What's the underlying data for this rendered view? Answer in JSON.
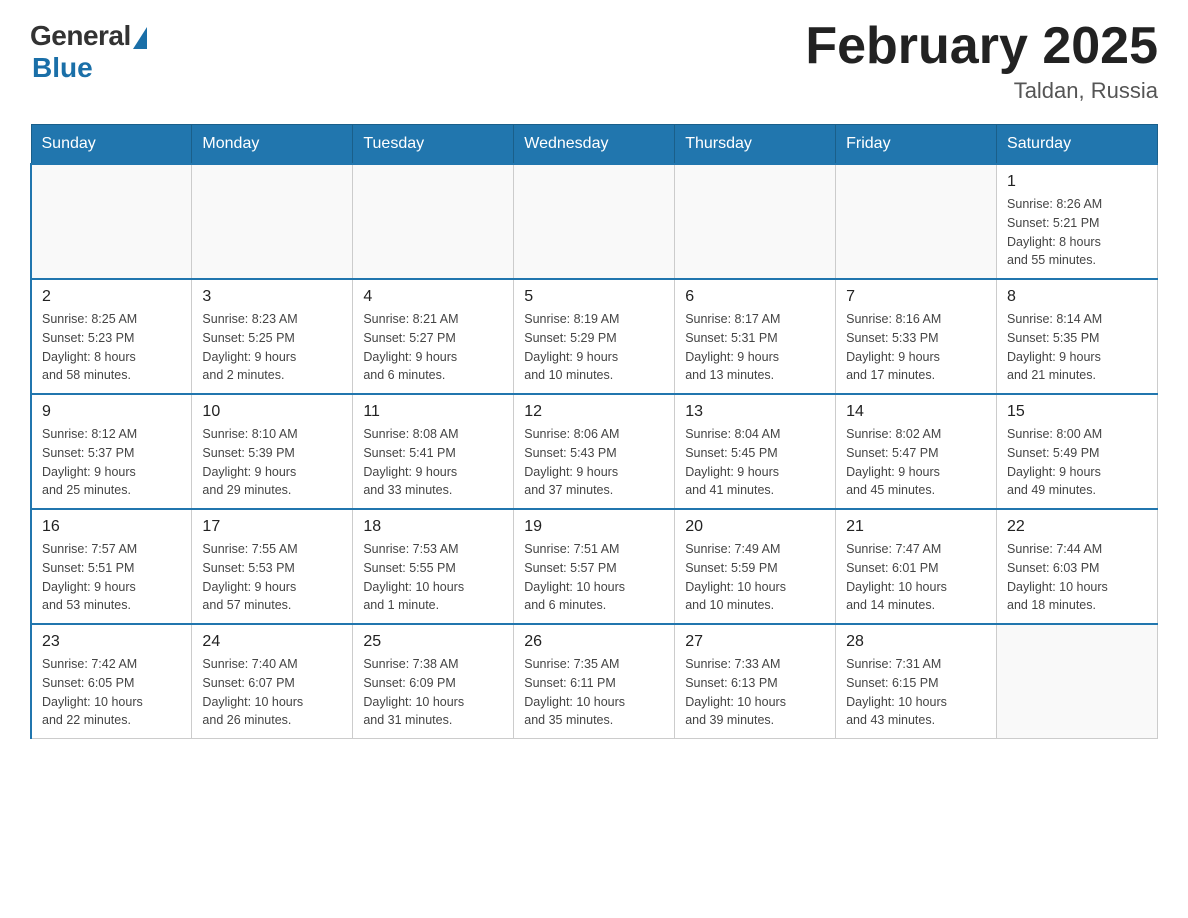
{
  "header": {
    "logo_general": "General",
    "logo_blue": "Blue",
    "month_title": "February 2025",
    "location": "Taldan, Russia"
  },
  "weekdays": [
    "Sunday",
    "Monday",
    "Tuesday",
    "Wednesday",
    "Thursday",
    "Friday",
    "Saturday"
  ],
  "weeks": [
    [
      {
        "day": "",
        "info": ""
      },
      {
        "day": "",
        "info": ""
      },
      {
        "day": "",
        "info": ""
      },
      {
        "day": "",
        "info": ""
      },
      {
        "day": "",
        "info": ""
      },
      {
        "day": "",
        "info": ""
      },
      {
        "day": "1",
        "info": "Sunrise: 8:26 AM\nSunset: 5:21 PM\nDaylight: 8 hours\nand 55 minutes."
      }
    ],
    [
      {
        "day": "2",
        "info": "Sunrise: 8:25 AM\nSunset: 5:23 PM\nDaylight: 8 hours\nand 58 minutes."
      },
      {
        "day": "3",
        "info": "Sunrise: 8:23 AM\nSunset: 5:25 PM\nDaylight: 9 hours\nand 2 minutes."
      },
      {
        "day": "4",
        "info": "Sunrise: 8:21 AM\nSunset: 5:27 PM\nDaylight: 9 hours\nand 6 minutes."
      },
      {
        "day": "5",
        "info": "Sunrise: 8:19 AM\nSunset: 5:29 PM\nDaylight: 9 hours\nand 10 minutes."
      },
      {
        "day": "6",
        "info": "Sunrise: 8:17 AM\nSunset: 5:31 PM\nDaylight: 9 hours\nand 13 minutes."
      },
      {
        "day": "7",
        "info": "Sunrise: 8:16 AM\nSunset: 5:33 PM\nDaylight: 9 hours\nand 17 minutes."
      },
      {
        "day": "8",
        "info": "Sunrise: 8:14 AM\nSunset: 5:35 PM\nDaylight: 9 hours\nand 21 minutes."
      }
    ],
    [
      {
        "day": "9",
        "info": "Sunrise: 8:12 AM\nSunset: 5:37 PM\nDaylight: 9 hours\nand 25 minutes."
      },
      {
        "day": "10",
        "info": "Sunrise: 8:10 AM\nSunset: 5:39 PM\nDaylight: 9 hours\nand 29 minutes."
      },
      {
        "day": "11",
        "info": "Sunrise: 8:08 AM\nSunset: 5:41 PM\nDaylight: 9 hours\nand 33 minutes."
      },
      {
        "day": "12",
        "info": "Sunrise: 8:06 AM\nSunset: 5:43 PM\nDaylight: 9 hours\nand 37 minutes."
      },
      {
        "day": "13",
        "info": "Sunrise: 8:04 AM\nSunset: 5:45 PM\nDaylight: 9 hours\nand 41 minutes."
      },
      {
        "day": "14",
        "info": "Sunrise: 8:02 AM\nSunset: 5:47 PM\nDaylight: 9 hours\nand 45 minutes."
      },
      {
        "day": "15",
        "info": "Sunrise: 8:00 AM\nSunset: 5:49 PM\nDaylight: 9 hours\nand 49 minutes."
      }
    ],
    [
      {
        "day": "16",
        "info": "Sunrise: 7:57 AM\nSunset: 5:51 PM\nDaylight: 9 hours\nand 53 minutes."
      },
      {
        "day": "17",
        "info": "Sunrise: 7:55 AM\nSunset: 5:53 PM\nDaylight: 9 hours\nand 57 minutes."
      },
      {
        "day": "18",
        "info": "Sunrise: 7:53 AM\nSunset: 5:55 PM\nDaylight: 10 hours\nand 1 minute."
      },
      {
        "day": "19",
        "info": "Sunrise: 7:51 AM\nSunset: 5:57 PM\nDaylight: 10 hours\nand 6 minutes."
      },
      {
        "day": "20",
        "info": "Sunrise: 7:49 AM\nSunset: 5:59 PM\nDaylight: 10 hours\nand 10 minutes."
      },
      {
        "day": "21",
        "info": "Sunrise: 7:47 AM\nSunset: 6:01 PM\nDaylight: 10 hours\nand 14 minutes."
      },
      {
        "day": "22",
        "info": "Sunrise: 7:44 AM\nSunset: 6:03 PM\nDaylight: 10 hours\nand 18 minutes."
      }
    ],
    [
      {
        "day": "23",
        "info": "Sunrise: 7:42 AM\nSunset: 6:05 PM\nDaylight: 10 hours\nand 22 minutes."
      },
      {
        "day": "24",
        "info": "Sunrise: 7:40 AM\nSunset: 6:07 PM\nDaylight: 10 hours\nand 26 minutes."
      },
      {
        "day": "25",
        "info": "Sunrise: 7:38 AM\nSunset: 6:09 PM\nDaylight: 10 hours\nand 31 minutes."
      },
      {
        "day": "26",
        "info": "Sunrise: 7:35 AM\nSunset: 6:11 PM\nDaylight: 10 hours\nand 35 minutes."
      },
      {
        "day": "27",
        "info": "Sunrise: 7:33 AM\nSunset: 6:13 PM\nDaylight: 10 hours\nand 39 minutes."
      },
      {
        "day": "28",
        "info": "Sunrise: 7:31 AM\nSunset: 6:15 PM\nDaylight: 10 hours\nand 43 minutes."
      },
      {
        "day": "",
        "info": ""
      }
    ]
  ]
}
